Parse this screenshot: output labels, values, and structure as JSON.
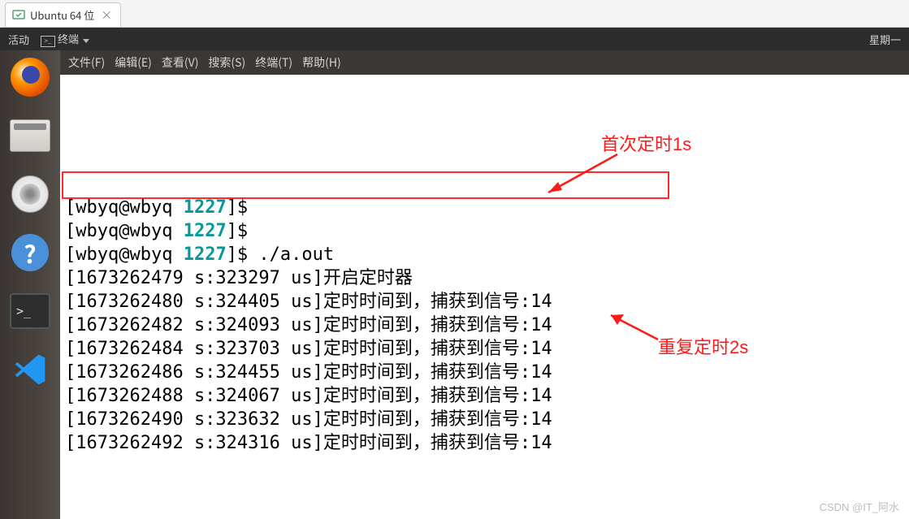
{
  "vm_tab": {
    "title": "Ubuntu 64 位",
    "close": "×"
  },
  "top_panel": {
    "activities": "活动",
    "app_label": "终端",
    "day_label": "星期一",
    "sub_label": "终"
  },
  "dock": {
    "help_glyph": "?",
    "terminal_glyph": ">_"
  },
  "menubar": {
    "file": "文件(F)",
    "edit": "编辑(E)",
    "view": "查看(V)",
    "search": "搜索(S)",
    "terminal": "终端(T)",
    "help": "帮助(H)"
  },
  "prompt": {
    "user_host": "wbyq@wbyq",
    "dir": "1227",
    "cmd_run": "./a.out"
  },
  "output": [
    {
      "ts": "1673262479",
      "us": "323297",
      "text": "开启定时器"
    },
    {
      "ts": "1673262480",
      "us": "324405",
      "text": "定时时间到，捕获到信号:14"
    },
    {
      "ts": "1673262482",
      "us": "324093",
      "text": "定时时间到，捕获到信号:14"
    },
    {
      "ts": "1673262484",
      "us": "323703",
      "text": "定时时间到，捕获到信号:14"
    },
    {
      "ts": "1673262486",
      "us": "324455",
      "text": "定时时间到，捕获到信号:14"
    },
    {
      "ts": "1673262488",
      "us": "324067",
      "text": "定时时间到，捕获到信号:14"
    },
    {
      "ts": "1673262490",
      "us": "323632",
      "text": "定时时间到，捕获到信号:14"
    },
    {
      "ts": "1673262492",
      "us": "324316",
      "text": "定时时间到，捕获到信号:14"
    }
  ],
  "annotations": {
    "first": "首次定时1s",
    "repeat": "重复定时2s"
  },
  "watermark": "CSDN @IT_阿水"
}
